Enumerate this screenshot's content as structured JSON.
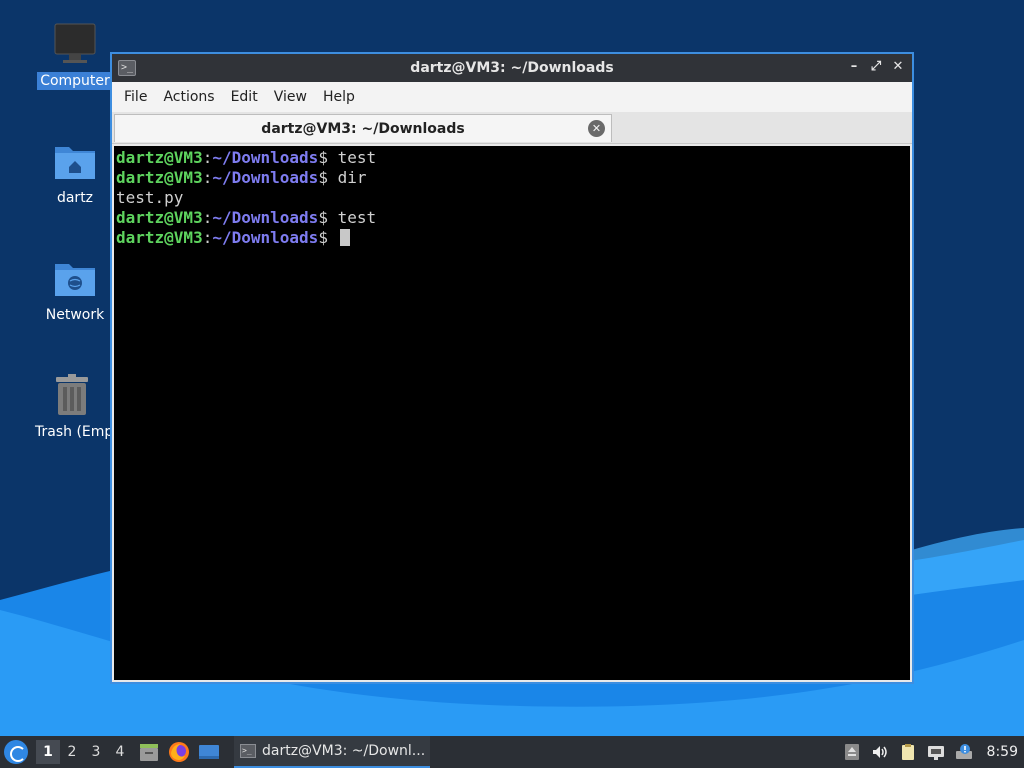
{
  "desktop": {
    "icons": [
      {
        "label": "Computer",
        "icon": "computer-icon"
      },
      {
        "label": "dartz",
        "icon": "home-folder-icon"
      },
      {
        "label": "Network",
        "icon": "network-folder-icon"
      },
      {
        "label": "Trash (Empt",
        "icon": "trash-icon"
      }
    ]
  },
  "window": {
    "title": "dartz@VM3: ~/Downloads",
    "controls": {
      "minimize": "–",
      "maximize": "⤢",
      "close": "✕"
    },
    "menu": [
      "File",
      "Actions",
      "Edit",
      "View",
      "Help"
    ],
    "tab": {
      "label": "dartz@VM3: ~/Downloads",
      "close": "✕"
    }
  },
  "terminal": {
    "lines": [
      {
        "user": "dartz@VM3",
        "colon": ":",
        "path": "~/Downloads",
        "prompt": "$ ",
        "cmd": "test"
      },
      {
        "user": "dartz@VM3",
        "colon": ":",
        "path": "~/Downloads",
        "prompt": "$ ",
        "cmd": "dir"
      },
      {
        "output": "test.py"
      },
      {
        "user": "dartz@VM3",
        "colon": ":",
        "path": "~/Downloads",
        "prompt": "$ ",
        "cmd": "test"
      },
      {
        "user": "dartz@VM3",
        "colon": ":",
        "path": "~/Downloads",
        "prompt": "$ ",
        "cmd": ""
      }
    ]
  },
  "taskbar": {
    "workspaces": [
      "1",
      "2",
      "3",
      "4"
    ],
    "active_workspace": "1",
    "task_label": "dartz@VM3: ~/Downl...",
    "clock": "8:59"
  },
  "colors": {
    "accent": "#3d8ee0",
    "prompt_user": "#5ed35e",
    "prompt_path": "#7e7cf0",
    "terminal_bg": "#000000"
  }
}
